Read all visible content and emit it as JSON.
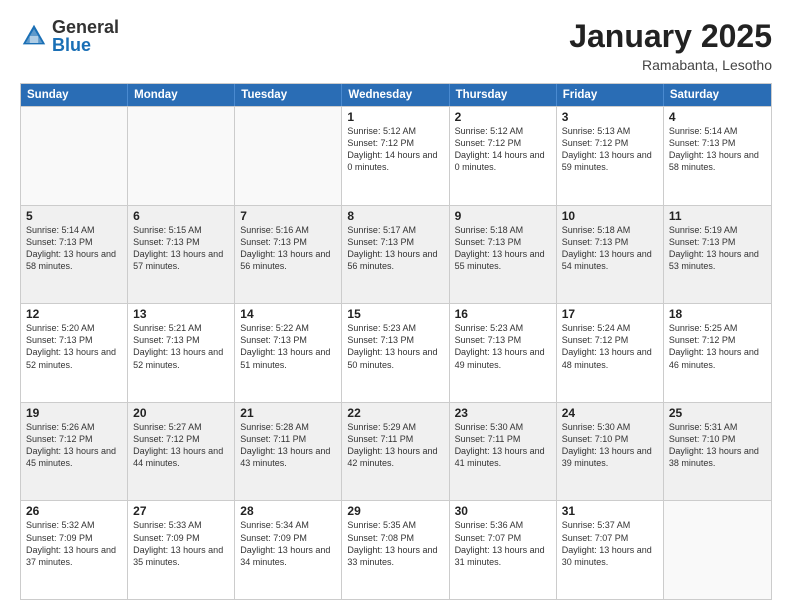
{
  "logo": {
    "general": "General",
    "blue": "Blue"
  },
  "header": {
    "month": "January 2025",
    "location": "Ramabanta, Lesotho"
  },
  "weekdays": [
    "Sunday",
    "Monday",
    "Tuesday",
    "Wednesday",
    "Thursday",
    "Friday",
    "Saturday"
  ],
  "rows": [
    [
      {
        "day": "",
        "empty": true
      },
      {
        "day": "",
        "empty": true
      },
      {
        "day": "",
        "empty": true
      },
      {
        "day": "1",
        "sunrise": "5:12 AM",
        "sunset": "7:12 PM",
        "daylight": "14 hours and 0 minutes."
      },
      {
        "day": "2",
        "sunrise": "5:12 AM",
        "sunset": "7:12 PM",
        "daylight": "14 hours and 0 minutes."
      },
      {
        "day": "3",
        "sunrise": "5:13 AM",
        "sunset": "7:12 PM",
        "daylight": "13 hours and 59 minutes."
      },
      {
        "day": "4",
        "sunrise": "5:14 AM",
        "sunset": "7:13 PM",
        "daylight": "13 hours and 58 minutes."
      }
    ],
    [
      {
        "day": "5",
        "sunrise": "5:14 AM",
        "sunset": "7:13 PM",
        "daylight": "13 hours and 58 minutes."
      },
      {
        "day": "6",
        "sunrise": "5:15 AM",
        "sunset": "7:13 PM",
        "daylight": "13 hours and 57 minutes."
      },
      {
        "day": "7",
        "sunrise": "5:16 AM",
        "sunset": "7:13 PM",
        "daylight": "13 hours and 56 minutes."
      },
      {
        "day": "8",
        "sunrise": "5:17 AM",
        "sunset": "7:13 PM",
        "daylight": "13 hours and 56 minutes."
      },
      {
        "day": "9",
        "sunrise": "5:18 AM",
        "sunset": "7:13 PM",
        "daylight": "13 hours and 55 minutes."
      },
      {
        "day": "10",
        "sunrise": "5:18 AM",
        "sunset": "7:13 PM",
        "daylight": "13 hours and 54 minutes."
      },
      {
        "day": "11",
        "sunrise": "5:19 AM",
        "sunset": "7:13 PM",
        "daylight": "13 hours and 53 minutes."
      }
    ],
    [
      {
        "day": "12",
        "sunrise": "5:20 AM",
        "sunset": "7:13 PM",
        "daylight": "13 hours and 52 minutes."
      },
      {
        "day": "13",
        "sunrise": "5:21 AM",
        "sunset": "7:13 PM",
        "daylight": "13 hours and 52 minutes."
      },
      {
        "day": "14",
        "sunrise": "5:22 AM",
        "sunset": "7:13 PM",
        "daylight": "13 hours and 51 minutes."
      },
      {
        "day": "15",
        "sunrise": "5:23 AM",
        "sunset": "7:13 PM",
        "daylight": "13 hours and 50 minutes."
      },
      {
        "day": "16",
        "sunrise": "5:23 AM",
        "sunset": "7:13 PM",
        "daylight": "13 hours and 49 minutes."
      },
      {
        "day": "17",
        "sunrise": "5:24 AM",
        "sunset": "7:12 PM",
        "daylight": "13 hours and 48 minutes."
      },
      {
        "day": "18",
        "sunrise": "5:25 AM",
        "sunset": "7:12 PM",
        "daylight": "13 hours and 46 minutes."
      }
    ],
    [
      {
        "day": "19",
        "sunrise": "5:26 AM",
        "sunset": "7:12 PM",
        "daylight": "13 hours and 45 minutes."
      },
      {
        "day": "20",
        "sunrise": "5:27 AM",
        "sunset": "7:12 PM",
        "daylight": "13 hours and 44 minutes."
      },
      {
        "day": "21",
        "sunrise": "5:28 AM",
        "sunset": "7:11 PM",
        "daylight": "13 hours and 43 minutes."
      },
      {
        "day": "22",
        "sunrise": "5:29 AM",
        "sunset": "7:11 PM",
        "daylight": "13 hours and 42 minutes."
      },
      {
        "day": "23",
        "sunrise": "5:30 AM",
        "sunset": "7:11 PM",
        "daylight": "13 hours and 41 minutes."
      },
      {
        "day": "24",
        "sunrise": "5:30 AM",
        "sunset": "7:10 PM",
        "daylight": "13 hours and 39 minutes."
      },
      {
        "day": "25",
        "sunrise": "5:31 AM",
        "sunset": "7:10 PM",
        "daylight": "13 hours and 38 minutes."
      }
    ],
    [
      {
        "day": "26",
        "sunrise": "5:32 AM",
        "sunset": "7:09 PM",
        "daylight": "13 hours and 37 minutes."
      },
      {
        "day": "27",
        "sunrise": "5:33 AM",
        "sunset": "7:09 PM",
        "daylight": "13 hours and 35 minutes."
      },
      {
        "day": "28",
        "sunrise": "5:34 AM",
        "sunset": "7:09 PM",
        "daylight": "13 hours and 34 minutes."
      },
      {
        "day": "29",
        "sunrise": "5:35 AM",
        "sunset": "7:08 PM",
        "daylight": "13 hours and 33 minutes."
      },
      {
        "day": "30",
        "sunrise": "5:36 AM",
        "sunset": "7:07 PM",
        "daylight": "13 hours and 31 minutes."
      },
      {
        "day": "31",
        "sunrise": "5:37 AM",
        "sunset": "7:07 PM",
        "daylight": "13 hours and 30 minutes."
      },
      {
        "day": "",
        "empty": true
      }
    ]
  ]
}
